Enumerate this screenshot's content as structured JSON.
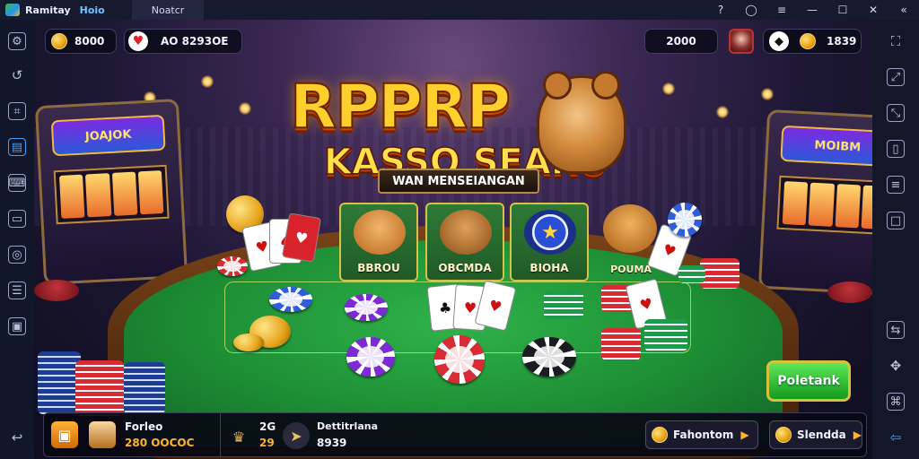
{
  "window": {
    "app_name": "Ramitay",
    "app_badge": "Hoio",
    "tab_title": "Noatcr",
    "controls": [
      "help-icon",
      "account-icon",
      "menu-icon",
      "minimize-icon",
      "maximize-icon",
      "close-icon",
      "collapse-icon"
    ]
  },
  "hud": {
    "coins_value": "8000",
    "likes_value": "AO 8293OE",
    "gold_value": "2000",
    "gems_value": "1839"
  },
  "title": {
    "line1": "RPPRP",
    "line2": "KASSO SEARU",
    "subtitle": "WAN MENSEIANGAN"
  },
  "slots": {
    "left_marquee": "JOAJOK",
    "right_marquee": "MOIBM"
  },
  "bet_options": [
    {
      "label": "BBROU"
    },
    {
      "label": "OBCMDA"
    },
    {
      "label": "BIOHA"
    },
    {
      "label": "POUMA"
    }
  ],
  "play_button": "Poletank",
  "bottom_bar": {
    "player_name": "Forleo",
    "player_balance": "280 OOCOC",
    "stat_value_top": "2G",
    "stat_value_bottom": "29",
    "middle_label": "Dettitrlana",
    "middle_value": "8939",
    "button_left": "Fahontom",
    "button_right": "Slendda"
  },
  "icons": [
    "coin-icon",
    "heart-icon",
    "gem-icon",
    "star-icon",
    "crown-icon"
  ],
  "colors": {
    "felt": "#1d8d34",
    "logo_gold": "#ffcf2e",
    "accent_blue": "#3da0ff",
    "play_green": "#159a1b"
  }
}
